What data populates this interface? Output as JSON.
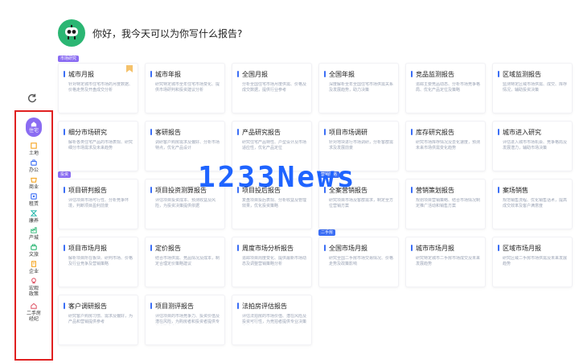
{
  "greeting": "你好，我今天可以为你写什么报告?",
  "sidebar": {
    "items": [
      {
        "label": "住宅",
        "icon": "home-icon"
      },
      {
        "label": "土地",
        "icon": "land-icon"
      },
      {
        "label": "办公",
        "icon": "office-icon"
      },
      {
        "label": "商业",
        "icon": "commerce-icon"
      },
      {
        "label": "租赁",
        "icon": "rent-icon"
      },
      {
        "label": "康养",
        "icon": "care-icon"
      },
      {
        "label": "产城",
        "icon": "industry-city-icon"
      },
      {
        "label": "文旅",
        "icon": "culture-tourism-icon"
      },
      {
        "label": "企业",
        "icon": "enterprise-icon"
      },
      {
        "label": "宏观\n政策",
        "icon": "macro-policy-icon"
      },
      {
        "label": "二手房\n经纪",
        "icon": "second-hand-icon"
      }
    ]
  },
  "tags": {
    "market": "市场研究",
    "invest": "投资",
    "sale": "营销策略",
    "second": "二手房"
  },
  "watermark": "1233News",
  "cards": [
    {
      "title": "城市月报",
      "desc": "针对特定城市住宅市场的月度数据、价格走势及开盘成交分析"
    },
    {
      "title": "城市年报",
      "desc": "研究特定城市全年住宅市场变化、提供市场研判和投资建议分析"
    },
    {
      "title": "全国月报",
      "desc": "分析全国住宅市场月度供需、价格及成交数据，提供行业参考"
    },
    {
      "title": "全国年报",
      "desc": "深度解析全年全国住宅市场供需关系及发展趋势，助力决策"
    },
    {
      "title": "竞品监测报告",
      "desc": "追踪主要竞品动态、分析市场竞争格局、优化产品定位及策略"
    },
    {
      "title": "区域监测报告",
      "desc": "监测特定区域市场供需、成交、库存情况，辅助投资决策"
    },
    {
      "title": "细分市场研究",
      "desc": "解析各类住宅产品的市场表现、研究细分市场需求及未来趋势"
    },
    {
      "title": "客研报告",
      "desc": "调研客户购房需求及偏好、分析市场特点，优化产品设计"
    },
    {
      "title": "产品研究报告",
      "desc": "研究住宅产品特性、户型设计及市场适应性，优化产品定位"
    },
    {
      "title": "项目市场调研",
      "desc": "针对地块进行市场调研，分析客群需求及发展前景"
    },
    {
      "title": "库存研究报告",
      "desc": "研究市场库存情况及去化速度，预测未来市场供需变化趋势"
    },
    {
      "title": "城市进入研究",
      "desc": "评估进入城市市场机会、竞争格局及发展潜力，辅助市场决策"
    },
    {
      "title": "项目研判报告",
      "desc": "评估项目市场可行性、分析竞争环境，判断项目盈利前景"
    },
    {
      "title": "项目投资测算报告",
      "desc": "评估项目投资成本、预测收益及风险，为投资决策提供依据"
    },
    {
      "title": "项目投后报告",
      "desc": "复盘项目投后表现、分析收益及管理效果，优化投资策略"
    },
    {
      "title": "全案营销报告",
      "desc": "研究项目市场及客群需求，制定全方位营销方案"
    },
    {
      "title": "营销策划报告",
      "desc": "规划项目营销策略、结合市场情况制定推广活动和销售方案"
    },
    {
      "title": "案场销售",
      "desc": "规范销售流程、优化销售话术，提高成交效率及客户满意度"
    },
    {
      "title": "项目市场月报",
      "desc": "解析项目所在板块、研判市场、价格及行业竞争及营销策略"
    },
    {
      "title": "定价报告",
      "desc": "结合市场供需、竞品情况及成本，制定合理定价策略建议"
    },
    {
      "title": "周度市场分析报告",
      "desc": "追踪项目周度变化、提供最新市场动态及调整营销策略分析"
    },
    {
      "title": "全国市场月报",
      "desc": "研究全国二手房市场交易情况、价格走势及政策影响"
    },
    {
      "title": "城市市场月报",
      "desc": "研究特定城市二手房市场成交及未来发展趋势"
    },
    {
      "title": "区域市场月报",
      "desc": "研究区域二手房市场供需及未来发展趋势"
    },
    {
      "title": "客户调研报告",
      "desc": "研究客户购房习惯、需求及偏好，为产品和营销提供参考"
    },
    {
      "title": "项目测评报告",
      "desc": "评估项目的市场竞争力、投资价值及潜在风险，为购房者和投资者提供专业决策参考"
    },
    {
      "title": "法拍房评估报告",
      "desc": "评估法拍房的市场价值、潜在风险及投资可行性，为竞拍者提供专业决策参考"
    }
  ]
}
